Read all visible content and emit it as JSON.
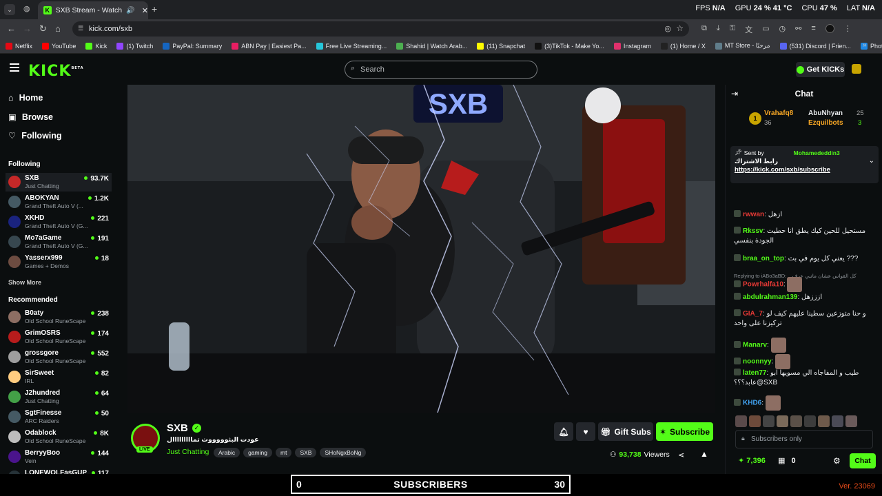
{
  "browser": {
    "tab_title": "SXB Stream - Watch Live on",
    "url": "kick.com/sxb",
    "sys": {
      "fps_label": "FPS",
      "fps": "N/A",
      "gpu_label": "GPU",
      "gpu": "24 %",
      "gpu_temp": "41 °C",
      "cpu_label": "CPU",
      "cpu": "47 %",
      "lat_label": "LAT",
      "lat": "N/A"
    },
    "bookmarks": [
      {
        "label": "Netflix",
        "color": "#e50914"
      },
      {
        "label": "YouTube",
        "color": "#ff0000"
      },
      {
        "label": "Kick",
        "color": "#53fc18"
      },
      {
        "label": "(1) Twitch",
        "color": "#9146ff"
      },
      {
        "label": "PayPal: Summary",
        "color": "#1565c0"
      },
      {
        "label": "ABN Pay | Easiest Pa...",
        "color": "#e91e63"
      },
      {
        "label": "Free Live Streaming...",
        "color": "#26c6da"
      },
      {
        "label": "Shahid | Watch Arab...",
        "color": "#4caf50"
      },
      {
        "label": "(11) Snapchat",
        "color": "#fffc00"
      },
      {
        "label": "(3)TikTok - Make Yo...",
        "color": "#111111"
      },
      {
        "label": "Instagram",
        "color": "#e1306c"
      },
      {
        "label": "(1) Home / X",
        "color": "#222222"
      },
      {
        "label": "MT Store - مرحبًا",
        "color": "#607d8b"
      },
      {
        "label": "(531) Discord | Frien...",
        "color": "#5865f2"
      },
      {
        "label": "Photopea | Online P...",
        "color": "#1e88e5"
      }
    ]
  },
  "header": {
    "logo": "KICK",
    "beta": "BETA",
    "search_placeholder": "Search",
    "get_kicks": "Get KICKs"
  },
  "sidebar": {
    "nav": [
      "Home",
      "Browse",
      "Following"
    ],
    "following_title": "Following",
    "following": [
      {
        "name": "SXB",
        "category": "Just Chatting",
        "viewers": "93.7K",
        "color": "#c62828"
      },
      {
        "name": "ABOKYAN",
        "category": "Grand Theft Auto V (...",
        "viewers": "1.2K",
        "color": "#455a64"
      },
      {
        "name": "XKHD",
        "category": "Grand Theft Auto V (G...",
        "viewers": "221",
        "color": "#1a237e"
      },
      {
        "name": "Mo7aGame",
        "category": "Grand Theft Auto V (G...",
        "viewers": "191",
        "color": "#37474f"
      },
      {
        "name": "Yasserx999",
        "category": "Games + Demos",
        "viewers": "18",
        "color": "#6d4c41"
      }
    ],
    "show_more": "Show More",
    "recommended_title": "Recommended",
    "recommended": [
      {
        "name": "B0aty",
        "category": "Old School RuneScape",
        "viewers": "238",
        "color": "#8d6e63"
      },
      {
        "name": "GrimOSRS",
        "category": "Old School RuneScape",
        "viewers": "174",
        "color": "#b71c1c"
      },
      {
        "name": "grossgore",
        "category": "Old School RuneScape",
        "viewers": "552",
        "color": "#9e9e9e"
      },
      {
        "name": "SirSweet",
        "category": "IRL",
        "viewers": "82",
        "color": "#ffcc80"
      },
      {
        "name": "J2hundred",
        "category": "Just Chatting",
        "viewers": "64",
        "color": "#43a047"
      },
      {
        "name": "SgtFinesse",
        "category": "ARC Raiders",
        "viewers": "50",
        "color": "#455a64"
      },
      {
        "name": "Odablock",
        "category": "Old School RuneScape",
        "viewers": "8K",
        "color": "#bdbdbd"
      },
      {
        "name": "BerryyBoo",
        "category": "Vein",
        "viewers": "144",
        "color": "#4a148c"
      },
      {
        "name": "LONEWOLFasGUP",
        "category": "",
        "viewers": "117",
        "color": "#263238"
      }
    ]
  },
  "stream": {
    "streamer": "SXB",
    "live": "LIVE",
    "title": "عودت البثوووووث تمااااااااال",
    "category": "Just Chatting",
    "tags": [
      "Arabic",
      "gaming",
      "mt",
      "SXB",
      "SHoNgxBoNg"
    ],
    "viewers": "93,738",
    "viewers_label": "Viewers",
    "gift_subs": "Gift Subs",
    "subscribe": "Subscribe",
    "overlay_text": "SXB"
  },
  "chat": {
    "title": "Chat",
    "leaders": [
      {
        "rank": "1",
        "name": "Vrahafq8",
        "count": "36"
      },
      {
        "name": "AbuNhyan",
        "count": "25"
      },
      {
        "name": "Ezquilbots",
        "count": "3"
      }
    ],
    "pinned": {
      "sent_by": "Sent by",
      "user": "Mohamededdin3",
      "title": "رابط الاشتراك",
      "link": "https://kick.com/sxb/subscribe"
    },
    "messages": [
      {
        "user": "rwwan",
        "color": "#e53935",
        "text": "ازهل"
      },
      {
        "user": "Rkssv",
        "color": "#53fc18",
        "text": "مستحيل للحين كيك يطق انا حطيت الجودة بنفسي"
      },
      {
        "user": "braa_on_top",
        "color": "#53fc18",
        "text": "يعني كل يوم في بث ???"
      },
      {
        "reply": "Replying to iABo3aBD: ...كل القواس عشان ماتبي عرف"
      },
      {
        "user": "Powrhalfa10",
        "color": "#e53935",
        "text": ""
      },
      {
        "user": "abdulrahman139",
        "color": "#53fc18",
        "text": "ازززهل"
      },
      {
        "user": "GIA_7",
        "color": "#e53935",
        "text": "و حنا متوزعين سطينا عليهم كيف لو تركيزنا على واحد"
      },
      {
        "user": "Manarv",
        "color": "#53fc18",
        "text": ""
      },
      {
        "user": "noonnyy",
        "color": "#53fc18",
        "text": ""
      },
      {
        "user": "laten77",
        "color": "#53fc18",
        "text": "طيب و المفاجاه الي مسويها ابو عابد؟؟؟@SXB"
      },
      {
        "user": "KHD6",
        "color": "#42a5f5",
        "text": ""
      }
    ],
    "subscribers_only": "Subscribers only",
    "kicks": "7,396",
    "gifts": "0",
    "send": "Chat"
  },
  "overlay_bar": {
    "left": "0",
    "label": "SUBSCRIBERS",
    "right": "30"
  },
  "version": "Ver. 23069"
}
